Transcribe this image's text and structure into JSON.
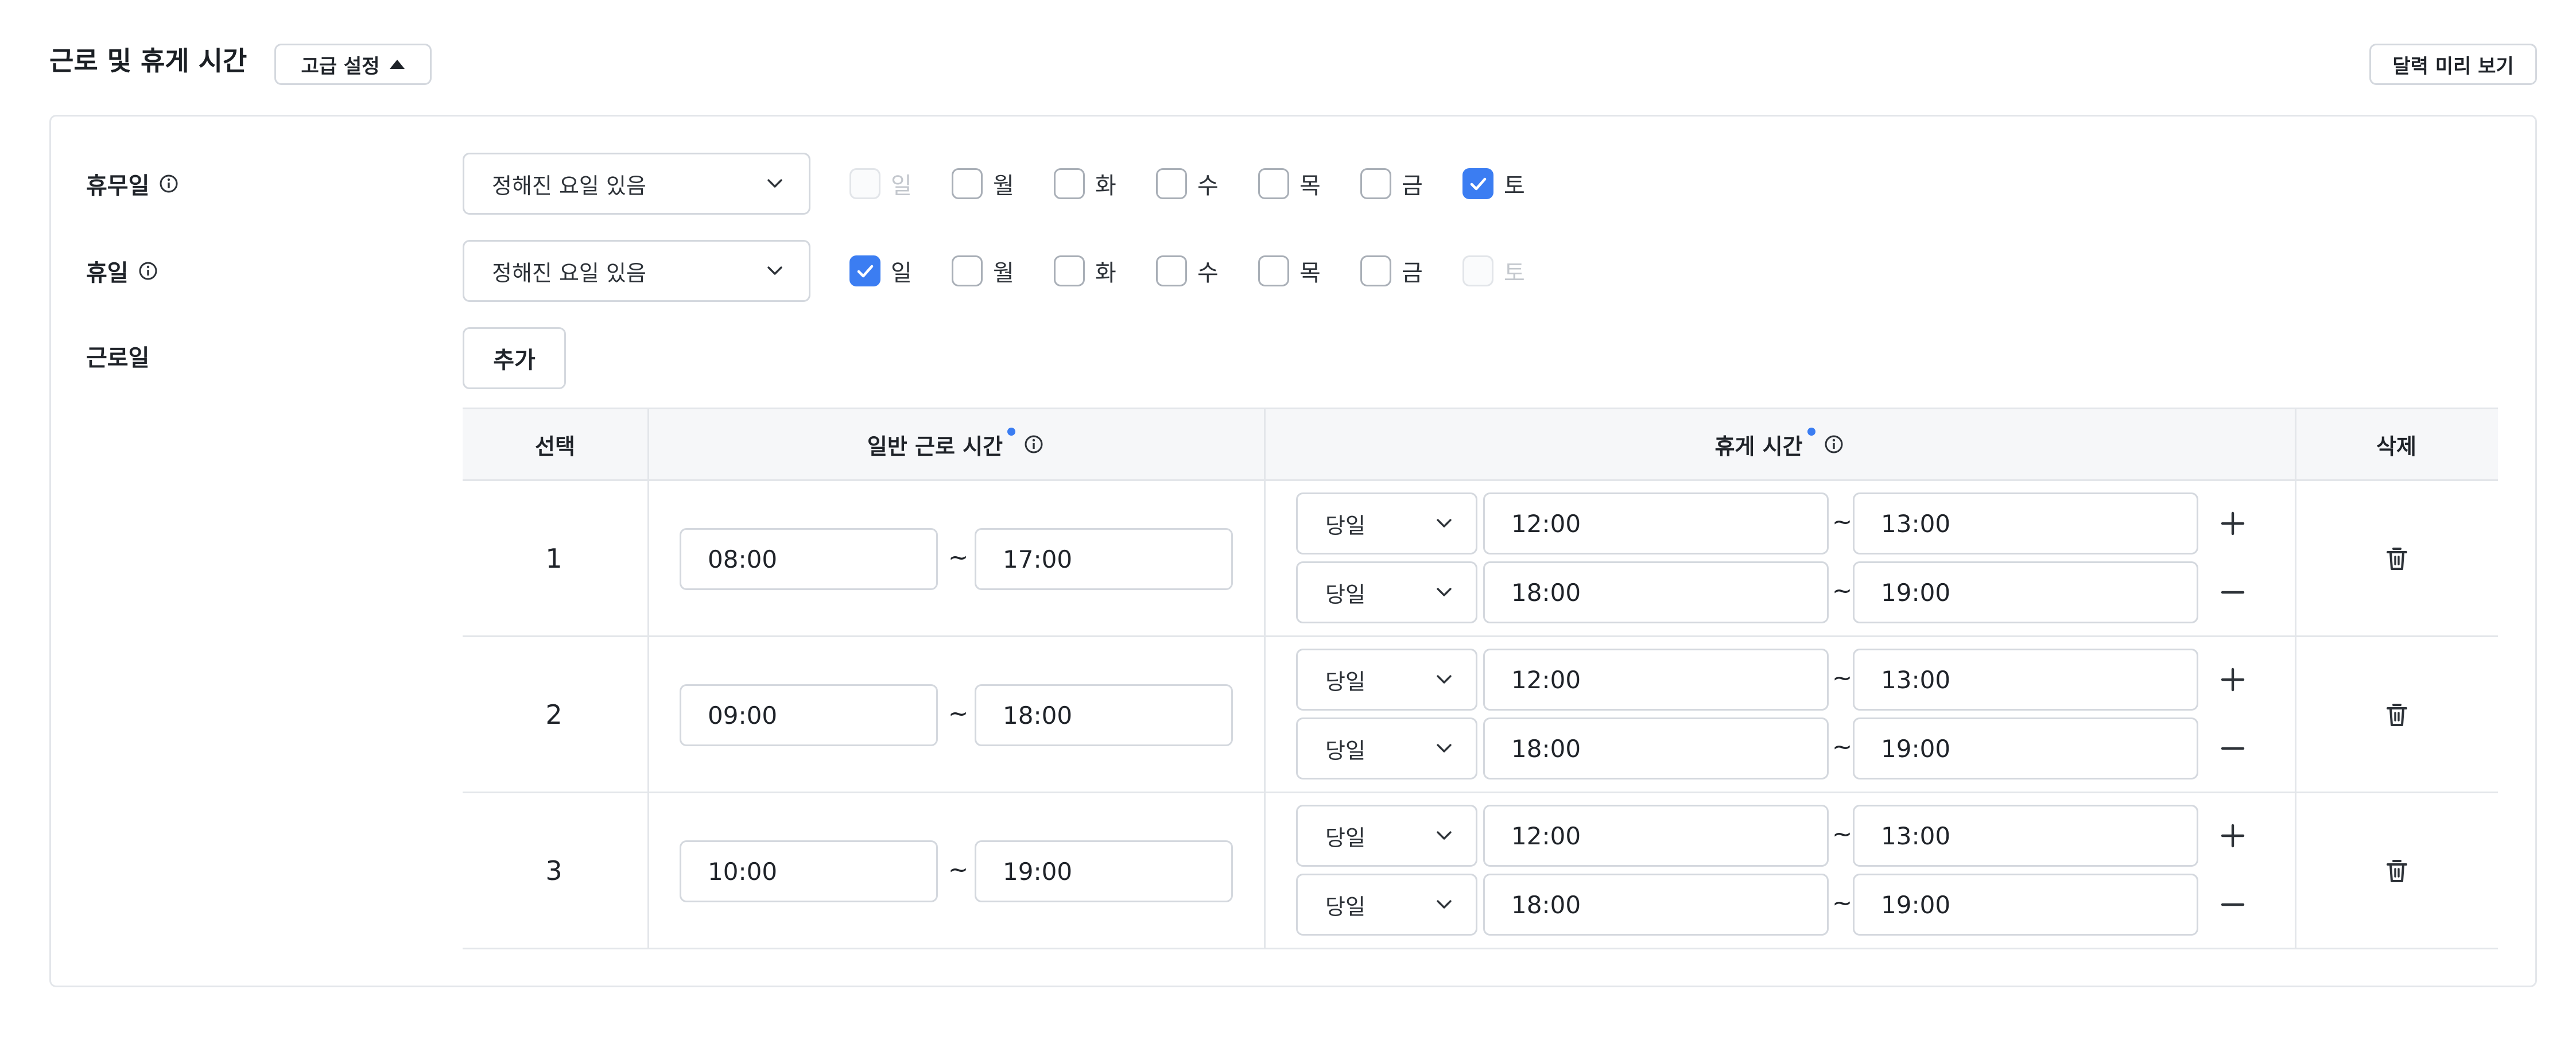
{
  "header": {
    "title": "근로 및 휴게 시간",
    "advanced_label": "고급 설정",
    "preview_label": "달력 미리 보기"
  },
  "colors": {
    "accent": "#3b7df2",
    "border": "#d4d8de",
    "header_bg": "#f6f7f9"
  },
  "unpaid_holiday": {
    "label": "휴무일",
    "select_value": "정해진 요일 있음",
    "days": [
      {
        "label": "일",
        "checked": false,
        "disabled": true
      },
      {
        "label": "월",
        "checked": false,
        "disabled": false
      },
      {
        "label": "화",
        "checked": false,
        "disabled": false
      },
      {
        "label": "수",
        "checked": false,
        "disabled": false
      },
      {
        "label": "목",
        "checked": false,
        "disabled": false
      },
      {
        "label": "금",
        "checked": false,
        "disabled": false
      },
      {
        "label": "토",
        "checked": true,
        "disabled": false
      }
    ]
  },
  "holiday": {
    "label": "휴일",
    "select_value": "정해진 요일 있음",
    "days": [
      {
        "label": "일",
        "checked": true,
        "disabled": false
      },
      {
        "label": "월",
        "checked": false,
        "disabled": false
      },
      {
        "label": "화",
        "checked": false,
        "disabled": false
      },
      {
        "label": "수",
        "checked": false,
        "disabled": false
      },
      {
        "label": "목",
        "checked": false,
        "disabled": false
      },
      {
        "label": "금",
        "checked": false,
        "disabled": false
      },
      {
        "label": "토",
        "checked": false,
        "disabled": true
      }
    ]
  },
  "workdays": {
    "label": "근로일",
    "add_label": "추가",
    "columns": {
      "select": "선택",
      "regular_hours": "일반 근로 시간",
      "break_time": "휴게 시간",
      "delete": "삭제"
    },
    "tilde": "~",
    "rows": [
      {
        "number": "1",
        "start": "08:00",
        "end": "17:00",
        "breaks": [
          {
            "day": "당일",
            "start": "12:00",
            "end": "13:00",
            "action": "add"
          },
          {
            "day": "당일",
            "start": "18:00",
            "end": "19:00",
            "action": "remove"
          }
        ]
      },
      {
        "number": "2",
        "start": "09:00",
        "end": "18:00",
        "breaks": [
          {
            "day": "당일",
            "start": "12:00",
            "end": "13:00",
            "action": "add"
          },
          {
            "day": "당일",
            "start": "18:00",
            "end": "19:00",
            "action": "remove"
          }
        ]
      },
      {
        "number": "3",
        "start": "10:00",
        "end": "19:00",
        "breaks": [
          {
            "day": "당일",
            "start": "12:00",
            "end": "13:00",
            "action": "add"
          },
          {
            "day": "당일",
            "start": "18:00",
            "end": "19:00",
            "action": "remove"
          }
        ]
      }
    ]
  }
}
